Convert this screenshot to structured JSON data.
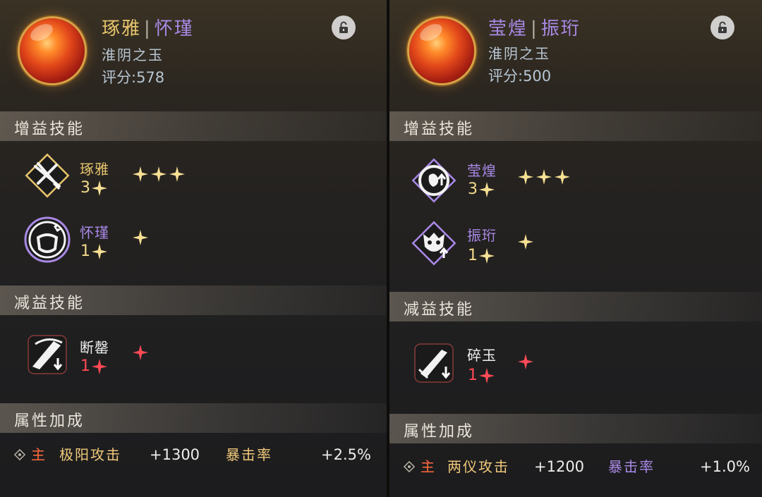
{
  "left": {
    "name_a": "琢雅",
    "separator": "|",
    "name_b": "怀瑾",
    "subtitle": "淮阴之玉",
    "score": "评分:578",
    "buff_section": "增益技能",
    "buff_skills": [
      {
        "name": "琢雅",
        "level": "3",
        "stars": 3,
        "icon": "crossed-swords-icon"
      },
      {
        "name": "怀瑾",
        "level": "1",
        "stars": 1,
        "icon": "shield-strike-icon"
      }
    ],
    "debuff_section": "减益技能",
    "debuff_skills": [
      {
        "name": "断罄",
        "level": "1",
        "stars": 1,
        "icon": "broken-blade-down-icon"
      }
    ],
    "attr_section": "属性加成",
    "attr": {
      "main": "主",
      "name_a": "极阳攻击",
      "val_a": "+1300",
      "name_b": "暴击率",
      "val_b": "+2.5%"
    }
  },
  "right": {
    "name_a": "莹煌",
    "separator": "|",
    "name_b": "振珩",
    "subtitle": "淮阴之玉",
    "score": "评分:500",
    "buff_section": "增益技能",
    "buff_skills": [
      {
        "name": "莹煌",
        "level": "3",
        "stars": 3,
        "icon": "shield-up-icon"
      },
      {
        "name": "振珩",
        "level": "1",
        "stars": 1,
        "icon": "demon-mask-up-icon"
      }
    ],
    "debuff_section": "减益技能",
    "debuff_skills": [
      {
        "name": "碎玉",
        "level": "1",
        "stars": 1,
        "icon": "sword-down-icon"
      }
    ],
    "attr_section": "属性加成",
    "attr": {
      "main": "主",
      "name_a": "两仪攻击",
      "val_a": "+1200",
      "name_b": "暴击率",
      "val_b": "+1.0%"
    }
  },
  "colors": {
    "gold": "#e7c46c",
    "purple": "#a989e6",
    "red": "#ff4a55",
    "star_gold": "#f6df93"
  }
}
